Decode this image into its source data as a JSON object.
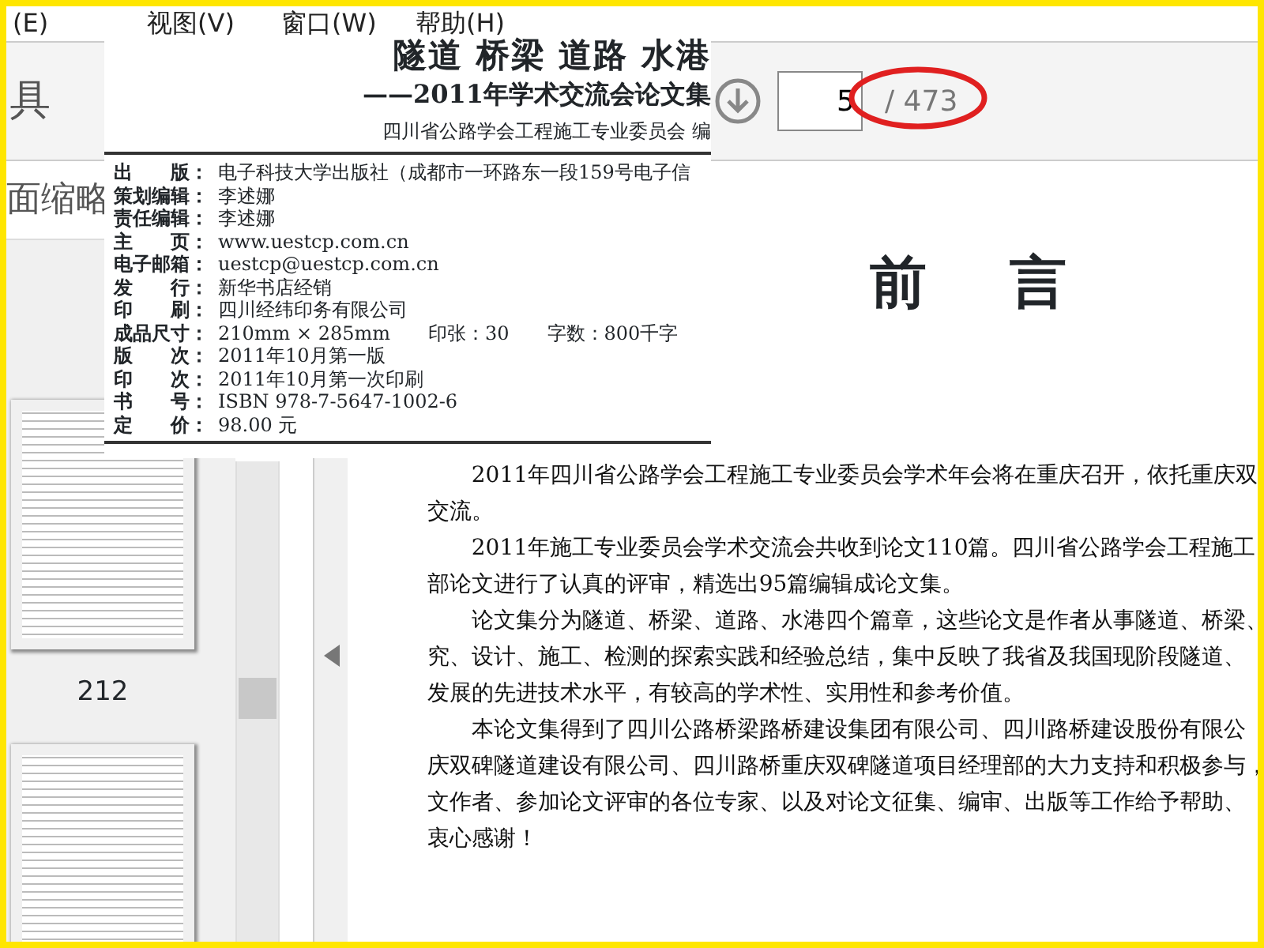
{
  "menu": [
    {
      "label": "(E)"
    },
    {
      "label": "视图(V)"
    },
    {
      "label": "窗口(W)"
    },
    {
      "label": "帮助(H)"
    }
  ],
  "toolbar": {
    "tools_label": "具",
    "page_input": "5",
    "page_total": "/ 473",
    "annotation": {
      "kind": "ellipse"
    }
  },
  "sidebar": {
    "title": "面缩略",
    "thumbnail_labels": [
      "212"
    ]
  },
  "book_info": {
    "title": "隧道 桥梁 道路 水港",
    "subtitle": "——2011年学术交流会论文集",
    "editor": "四川省公路学会工程施工专业委员会 编",
    "rows": [
      {
        "label": "出　　版：",
        "value": "电子科技大学出版社（成都市一环路东一段159号电子信"
      },
      {
        "label": "策划编辑：",
        "value": "李述娜"
      },
      {
        "label": "责任编辑：",
        "value": "李述娜"
      },
      {
        "label": "主　　页：",
        "value": "www.uestcp.com.cn"
      },
      {
        "label": "电子邮箱：",
        "value": "uestcp@uestcp.com.cn"
      },
      {
        "label": "发　　行：",
        "value": "新华书店经销"
      },
      {
        "label": "印　　刷：",
        "value": "四川经纬印务有限公司"
      },
      {
        "label": "成品尺寸：",
        "value": "210mm × 285mm　　印张：30　　字数：800千字"
      },
      {
        "label": "版　　次：",
        "value": "2011年10月第一版"
      },
      {
        "label": "印　　次：",
        "value": "2011年10月第一次印刷"
      },
      {
        "label": "书　　号：",
        "value": "ISBN 978-7-5647-1002-6"
      },
      {
        "label": "定　　价：",
        "value": "98.00 元"
      }
    ]
  },
  "document": {
    "heading": "前 言",
    "paragraphs": [
      {
        "lines": [
          "2011年四川省公路学会工程施工专业委员会学术年会将在重庆召开，依托重庆双",
          "交流。"
        ]
      },
      {
        "lines": [
          "2011年施工专业委员会学术交流会共收到论文110篇。四川省公路学会工程施工",
          "部论文进行了认真的评审，精选出95篇编辑成论文集。"
        ]
      },
      {
        "lines": [
          "论文集分为隧道、桥梁、道路、水港四个篇章，这些论文是作者从事隧道、桥梁、",
          "究、设计、施工、检测的探索实践和经验总结，集中反映了我省及我国现阶段隧道、",
          "发展的先进技术水平，有较高的学术性、实用性和参考价值。"
        ]
      },
      {
        "lines": [
          "本论文集得到了四川公路桥梁路桥建设集团有限公司、四川路桥建设股份有限公",
          "庆双碑隧道建设有限公司、四川路桥重庆双碑隧道项目经理部的大力支持和积极参与，",
          "文作者、参加论文评审的各位专家、以及对论文征集、编审、出版等工作给予帮助、",
          "衷心感谢！"
        ]
      }
    ]
  }
}
